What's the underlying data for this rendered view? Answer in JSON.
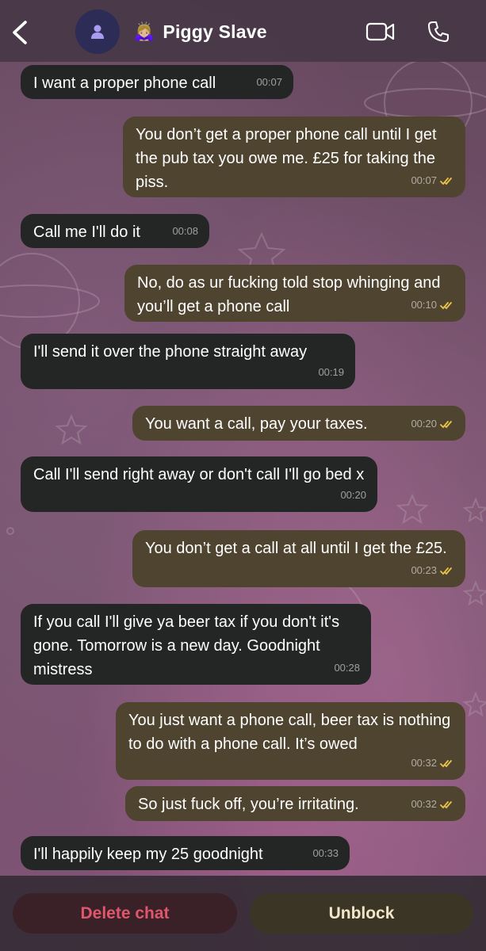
{
  "header": {
    "title": "Piggy Slave",
    "title_emoji": "🙇🏼‍♀️",
    "avatar_icon": "person-icon",
    "back_icon": "chevron-left-icon",
    "video_icon": "video-camera-icon",
    "call_icon": "phone-icon"
  },
  "messages": [
    {
      "dir": "in",
      "text": "I want a proper phone call",
      "time": "00:07"
    },
    {
      "dir": "out",
      "text": "You don’t get a proper phone call until I get the pub tax you owe me. £25 for taking the piss.",
      "time": "00:07",
      "status": "read"
    },
    {
      "dir": "in",
      "text": "Call me I'll do it",
      "time": "00:08"
    },
    {
      "dir": "out",
      "text": "No, do as ur fucking told stop whinging and you’ll get a phone call",
      "time": "00:10",
      "status": "read"
    },
    {
      "dir": "in",
      "text": "I'll send it over the phone straight away",
      "time": "00:19"
    },
    {
      "dir": "out",
      "text": "You want a call, pay your taxes.",
      "time": "00:20",
      "status": "read"
    },
    {
      "dir": "in",
      "text": "Call I'll send right away or don't call I'll go bed x",
      "time": "00:20"
    },
    {
      "dir": "out",
      "text": "You don’t get a call at all until I get the £25.",
      "time": "00:23",
      "status": "read"
    },
    {
      "dir": "in",
      "text": "If you call I'll give ya beer tax if you don't it's gone. Tomorrow is a new day. Goodnight mistress",
      "time": "00:28"
    },
    {
      "dir": "out",
      "text": "You just want a phone call, beer tax is nothing to do with a phone call. It’s owed",
      "time": "00:32",
      "status": "read"
    },
    {
      "dir": "out",
      "text": "So just fuck off, you’re irritating.",
      "time": "00:32",
      "status": "read"
    },
    {
      "dir": "in",
      "text": "I'll happily keep my 25 goodnight",
      "time": "00:33"
    }
  ],
  "footer": {
    "delete_label": "Delete chat",
    "unblock_label": "Unblock"
  },
  "colors": {
    "incoming_bubble": "#242626",
    "outgoing_bubble": "#4f4430",
    "read_ticks": "#e8c24a",
    "delete_text": "#e0566c"
  }
}
